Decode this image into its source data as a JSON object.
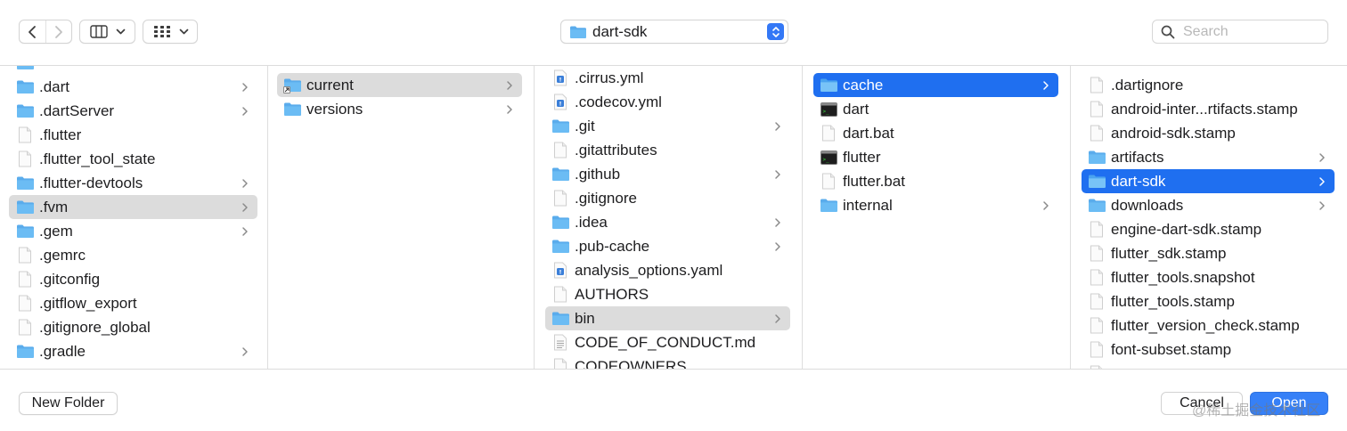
{
  "toolbar": {
    "path_label": "dart-sdk",
    "search_placeholder": "Search"
  },
  "columns": [
    {
      "items": [
        {
          "name": "",
          "type": "folder",
          "chevron": false
        },
        {
          "name": ".dart",
          "type": "folder",
          "chevron": true
        },
        {
          "name": ".dartServer",
          "type": "folder",
          "chevron": true
        },
        {
          "name": ".flutter",
          "type": "file",
          "chevron": false
        },
        {
          "name": ".flutter_tool_state",
          "type": "file",
          "chevron": false
        },
        {
          "name": ".flutter-devtools",
          "type": "folder",
          "chevron": true
        },
        {
          "name": ".fvm",
          "type": "folder",
          "chevron": true,
          "selected": "grey"
        },
        {
          "name": ".gem",
          "type": "folder",
          "chevron": true
        },
        {
          "name": ".gemrc",
          "type": "file",
          "chevron": false
        },
        {
          "name": ".gitconfig",
          "type": "file",
          "chevron": false
        },
        {
          "name": ".gitflow_export",
          "type": "file",
          "chevron": false
        },
        {
          "name": ".gitignore_global",
          "type": "file",
          "chevron": false
        },
        {
          "name": ".gradle",
          "type": "folder",
          "chevron": true
        },
        {
          "name": "",
          "type": "folder",
          "chevron": false
        }
      ]
    },
    {
      "items": [
        {
          "name": "current",
          "type": "alias",
          "chevron": true,
          "selected": "grey"
        },
        {
          "name": "versions",
          "type": "folder",
          "chevron": true
        }
      ]
    },
    {
      "items": [
        {
          "name": ".cirrus.yml",
          "type": "yaml",
          "chevron": false
        },
        {
          "name": ".codecov.yml",
          "type": "yaml",
          "chevron": false
        },
        {
          "name": ".git",
          "type": "folder",
          "chevron": true
        },
        {
          "name": ".gitattributes",
          "type": "file",
          "chevron": false
        },
        {
          "name": ".github",
          "type": "folder",
          "chevron": true
        },
        {
          "name": ".gitignore",
          "type": "file",
          "chevron": false
        },
        {
          "name": ".idea",
          "type": "folder",
          "chevron": true
        },
        {
          "name": ".pub-cache",
          "type": "folder",
          "chevron": true
        },
        {
          "name": "analysis_options.yaml",
          "type": "yaml",
          "chevron": false
        },
        {
          "name": "AUTHORS",
          "type": "file",
          "chevron": false
        },
        {
          "name": "bin",
          "type": "folder",
          "chevron": true,
          "selected": "grey"
        },
        {
          "name": "CODE_OF_CONDUCT.md",
          "type": "text",
          "chevron": false
        },
        {
          "name": "CODEOWNERS",
          "type": "file",
          "chevron": false
        }
      ]
    },
    {
      "items": [
        {
          "name": "cache",
          "type": "folder",
          "chevron": true,
          "selected": "blue"
        },
        {
          "name": "dart",
          "type": "exec",
          "chevron": false
        },
        {
          "name": "dart.bat",
          "type": "file",
          "chevron": false
        },
        {
          "name": "flutter",
          "type": "exec",
          "chevron": false
        },
        {
          "name": "flutter.bat",
          "type": "file",
          "chevron": false
        },
        {
          "name": "internal",
          "type": "folder",
          "chevron": true
        }
      ]
    },
    {
      "items": [
        {
          "name": ".dartignore",
          "type": "file",
          "chevron": false
        },
        {
          "name": "android-inter...rtifacts.stamp",
          "type": "file",
          "chevron": false
        },
        {
          "name": "android-sdk.stamp",
          "type": "file",
          "chevron": false
        },
        {
          "name": "artifacts",
          "type": "folder",
          "chevron": true
        },
        {
          "name": "dart-sdk",
          "type": "folder",
          "chevron": true,
          "selected": "blue"
        },
        {
          "name": "downloads",
          "type": "folder",
          "chevron": true
        },
        {
          "name": "engine-dart-sdk.stamp",
          "type": "file",
          "chevron": false
        },
        {
          "name": "flutter_sdk.stamp",
          "type": "file",
          "chevron": false
        },
        {
          "name": "flutter_tools.snapshot",
          "type": "file",
          "chevron": false
        },
        {
          "name": "flutter_tools.stamp",
          "type": "file",
          "chevron": false
        },
        {
          "name": "flutter_version_check.stamp",
          "type": "file",
          "chevron": false
        },
        {
          "name": "font-subset.stamp",
          "type": "file",
          "chevron": false
        },
        {
          "name": "",
          "type": "file",
          "chevron": false
        }
      ]
    }
  ],
  "footer": {
    "new_folder_label": "New Folder",
    "cancel_label": "Cancel",
    "open_label": "Open",
    "watermark": "@稀土掘金技术社区"
  },
  "colors": {
    "accent": "#1f6ff0",
    "folder": "#5aacec",
    "grey_selection": "#dcdcdc"
  }
}
